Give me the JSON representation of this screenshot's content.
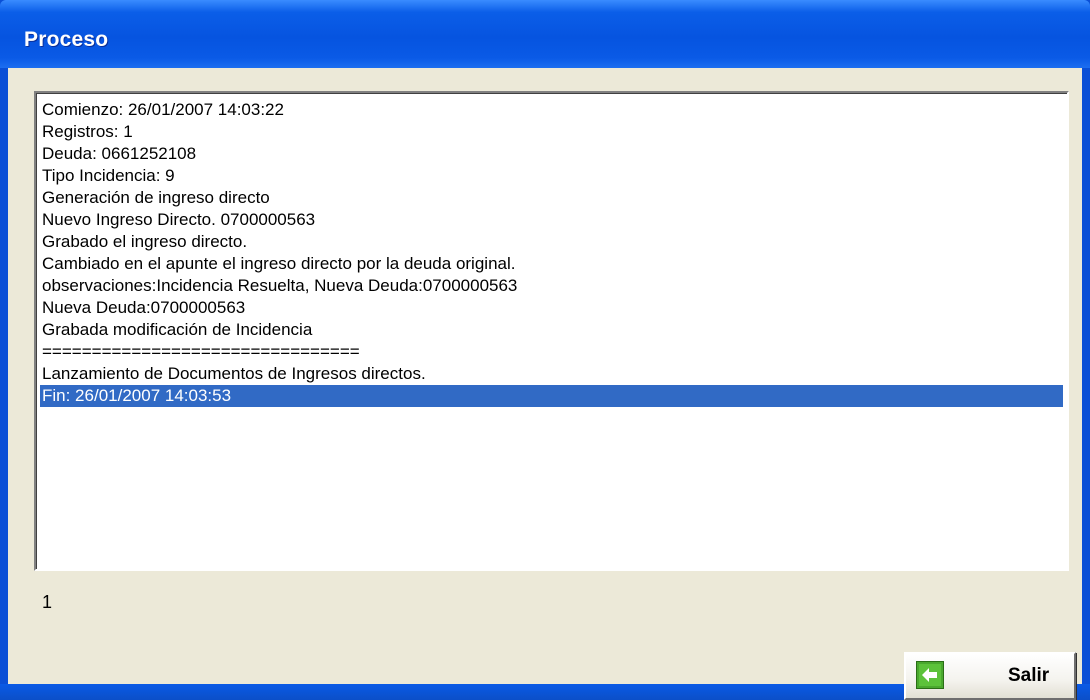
{
  "window": {
    "title": "Proceso"
  },
  "log": {
    "lines": [
      "Comienzo: 26/01/2007 14:03:22",
      "Registros: 1",
      "Deuda: 0661252108",
      "Tipo Incidencia: 9",
      "Generación de ingreso directo",
      "Nuevo Ingreso Directo. 0700000563",
      "Grabado el ingreso directo.",
      "Cambiado en el apunte el ingreso directo por la deuda original.",
      "observaciones:Incidencia Resuelta, Nueva Deuda:0700000563",
      "Nueva Deuda:0700000563",
      "Grabada modificación de Incidencia",
      "================================",
      "Lanzamiento de Documentos de Ingresos directos.",
      "Fin: 26/01/2007 14:03:53"
    ],
    "selected_index": 13
  },
  "status": {
    "count": "1"
  },
  "buttons": {
    "exit_label": "Salir",
    "exit_icon": "exit-arrow-icon"
  },
  "colors": {
    "titlebar": "#0654e0",
    "selection": "#316ac5",
    "window_bg": "#ece9d8"
  }
}
